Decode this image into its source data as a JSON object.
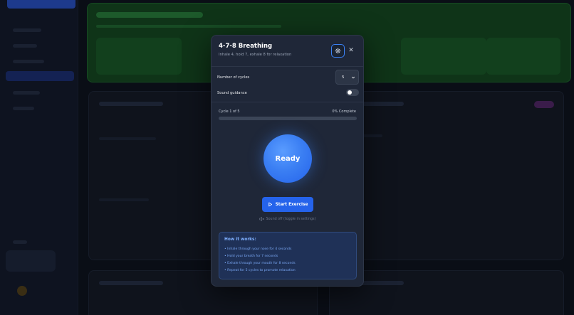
{
  "modal": {
    "title": "4-7-8 Breathing",
    "subtitle": "Inhale 4, hold 7, exhale 8 for relaxation",
    "settings_icon": "gear-icon",
    "close_icon": "close-icon",
    "close_label": "✕",
    "cycles": {
      "label": "Number of cycles",
      "value": "5"
    },
    "sound": {
      "label": "Sound guidance",
      "enabled": false
    },
    "progress": {
      "cycle_text": "Cycle 1 of 5",
      "percent_text": "0% Complete",
      "fraction": 0
    },
    "circle_text": "Ready",
    "start_button": {
      "label": "Start Exercise",
      "icon": "play-icon"
    },
    "sound_note": {
      "text": "Sound off (toggle in settings)",
      "icon": "speaker-off-icon"
    },
    "how_it_works": {
      "title": "How it works:",
      "items": [
        "• Inhale through your nose for 4 seconds",
        "• Hold your breath for 7 seconds",
        "• Exhale through your mouth for 8 seconds",
        "• Repeat for 5 cycles to promote relaxation"
      ]
    }
  },
  "colors": {
    "accent": "#3b82f6",
    "primary_button": "#2563eb",
    "modal_bg": "#1f2738",
    "info_box_bg": "#1f3157",
    "banner_green": "#0f3418"
  }
}
